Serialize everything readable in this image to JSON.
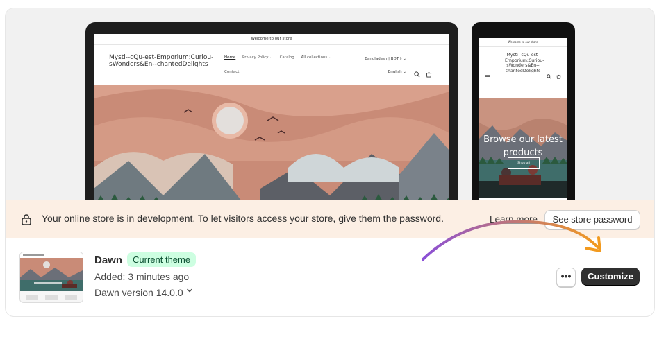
{
  "preview": {
    "desktop": {
      "announcement": "Welcome to our store",
      "logo_text": "Mysti--cQu-est-Emporium:Curiou-sWonders&En--chantedDelights",
      "nav": [
        "Home",
        "Privacy Policy ⌄",
        "Catalog",
        "All collections ⌄"
      ],
      "nav_second_row": "Contact",
      "country": "Bangladesh | BDT ৳ ⌄",
      "language": "English ⌄"
    },
    "mobile": {
      "announcement": "Welcome to our store",
      "logo_text": "Mysti--cQu-est-Emporium:Curiou-sWonders&En--chantedDelights",
      "hero_title": "Browse our latest products",
      "hero_button": "Shop all"
    }
  },
  "banner": {
    "message": "Your online store is in development. To let visitors access your store, give them the password.",
    "learn_more": "Learn more",
    "password_button": "See store password"
  },
  "theme": {
    "name": "Dawn",
    "badge": "Current theme",
    "added": "Added: 3 minutes ago",
    "version": "Dawn version 14.0.0",
    "more_button": "•••",
    "customize_button": "Customize"
  },
  "icons": {
    "banner": "lock-icon",
    "version_toggle": "chevron-down-icon",
    "more": "ellipsis-icon",
    "search": "search-icon",
    "cart": "cart-icon",
    "menu": "hamburger-icon"
  },
  "colors": {
    "banner_bg": "#fcefe4",
    "badge_bg": "#cdfee1",
    "badge_text": "#0c5132",
    "primary_button": "#303030",
    "arrow_start": "#8a4fd8",
    "arrow_end": "#f29a1f"
  }
}
